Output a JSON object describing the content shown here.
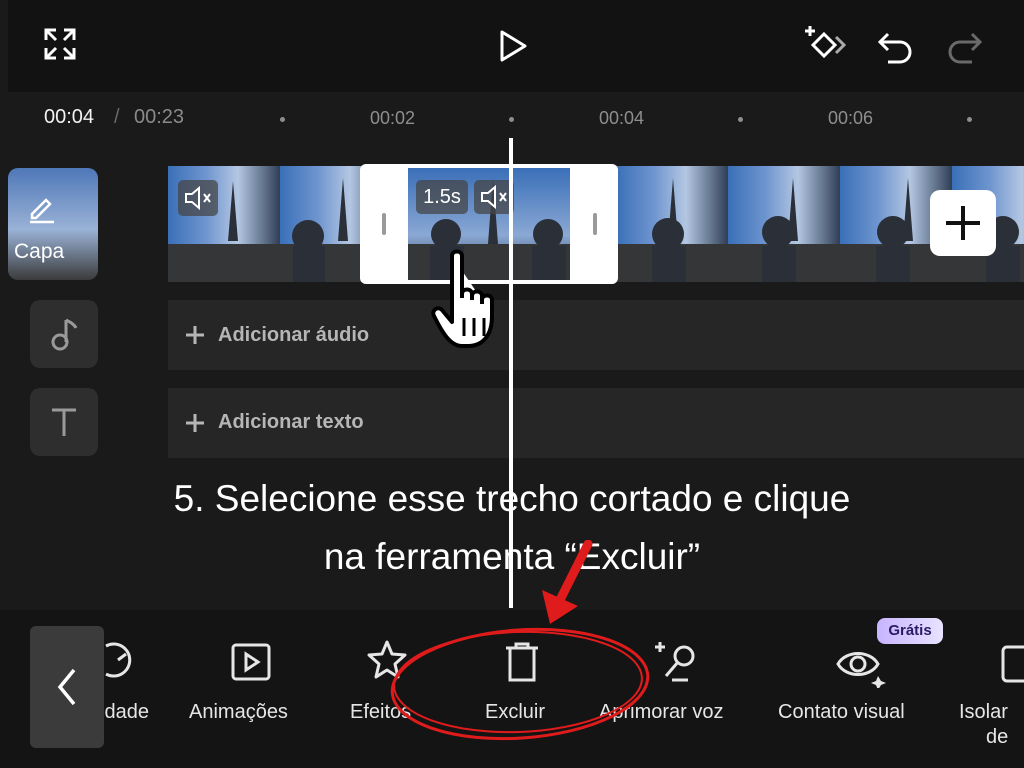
{
  "header": {
    "expand_icon": "expand-icon",
    "play_icon": "play-icon",
    "keyframe_icon": "add-keyframe-icon",
    "undo_icon": "undo-icon",
    "redo_icon": "redo-icon"
  },
  "timeline": {
    "current_time": "00:04",
    "separator": "/",
    "total_time": "00:23",
    "ticks": [
      "00:02",
      "00:04",
      "00:06"
    ]
  },
  "tracks": {
    "cover_label": "Capa",
    "selected_duration": "1.5s",
    "add_audio": "Adicionar áudio",
    "add_text": "Adicionar texto"
  },
  "instruction": {
    "line1": "5. Selecione esse trecho cortado e clique",
    "line2": "na ferramenta “Excluir”"
  },
  "toolbar": {
    "items": [
      {
        "label": "idade",
        "icon": "speed-icon"
      },
      {
        "label": "Animações",
        "icon": "animation-icon"
      },
      {
        "label": "Efeitos",
        "icon": "effects-icon"
      },
      {
        "label": "Excluir",
        "icon": "delete-icon"
      },
      {
        "label": "Aprimorar voz",
        "icon": "enhance-voice-icon"
      },
      {
        "label": "Contato visual",
        "icon": "eye-contact-icon"
      },
      {
        "label": "Isolar",
        "icon": "isolate-icon"
      },
      {
        "label": "de",
        "icon": ""
      }
    ],
    "badge": "Grátis"
  },
  "colors": {
    "highlight_red": "#e01b1b",
    "background": "#1a1a1a",
    "accent_badge": "#c7b4ff"
  }
}
